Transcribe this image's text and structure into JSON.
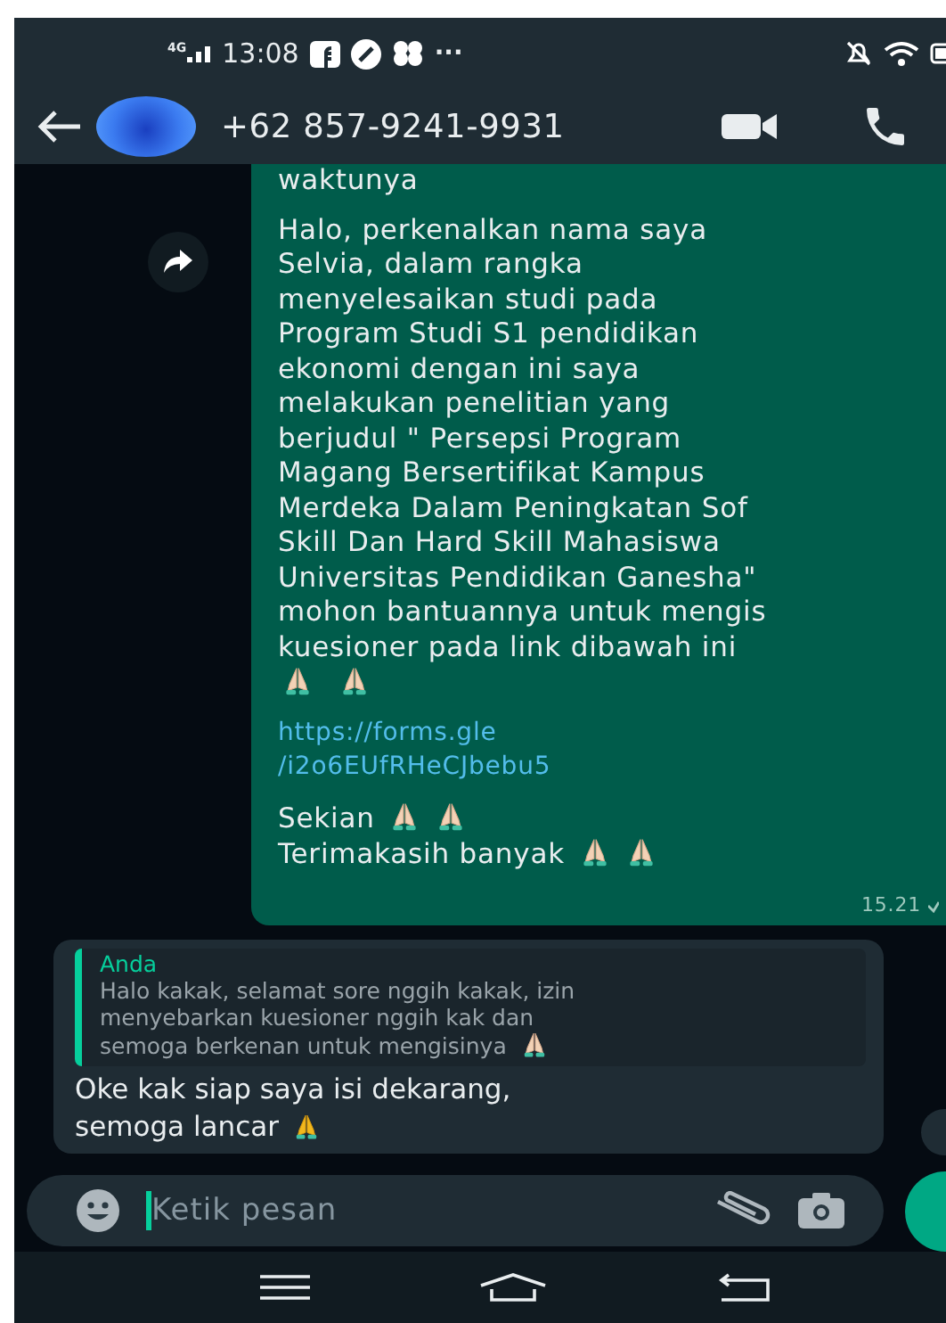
{
  "status_bar": {
    "network": "4G",
    "time": "13:08",
    "more": "···"
  },
  "header": {
    "contact": "+62 857-9241-9931"
  },
  "messages": [
    {
      "kind": "outgoing",
      "time": "15.21",
      "blocks": [
        [
          [
            {
              "kind": "text",
              "text": "waktunya"
            }
          ]
        ],
        [
          [
            {
              "kind": "text",
              "text": "Halo, perkenalkan nama saya\nSelvia, dalam rangka\nmenyelesaikan studi pada\nProgram Studi S1 pendidikan\nekonomi dengan ini saya\nmelakukan penelitian yang\nberjudul \" Persepsi Program\nMagang Bersertifikat Kampus\nMerdeka Dalam Peningkatan Sof\nSkill Dan Hard Skill Mahasiswa\nUniversitas Pendidikan Ganesha\"\nmohon bantuannya untuk mengis\nkuesioner pada link dibawah ini"
            }
          ],
          [
            {
              "kind": "praying-hands-light"
            },
            {
              "kind": "praying-hands-light"
            }
          ]
        ],
        [
          [
            {
              "kind": "link",
              "text": "https://forms.gle\n/i2o6EUfRHeCJbebu5"
            }
          ]
        ],
        [
          [
            {
              "kind": "text",
              "text": "Sekian"
            },
            {
              "kind": "praying-hands-light"
            },
            {
              "kind": "praying-hands-light"
            }
          ],
          [
            {
              "kind": "text",
              "text": "Terimakasih banyak"
            },
            {
              "kind": "praying-hands-light"
            },
            {
              "kind": "praying-hands-light"
            }
          ]
        ]
      ]
    },
    {
      "kind": "incoming",
      "quote": {
        "author": "Anda",
        "lines": [
          [
            {
              "kind": "text",
              "text": "Halo kakak, selamat sore nggih kakak, izin\nmenyebarkan kuesioner nggih kak dan"
            }
          ],
          [
            {
              "kind": "text",
              "text": "semoga berkenan untuk mengisinya"
            },
            {
              "kind": "praying-hands-light"
            }
          ]
        ]
      },
      "blocks": [
        [
          [
            {
              "kind": "text",
              "text": "Oke kak siap saya isi dekarang,"
            }
          ],
          [
            {
              "kind": "text",
              "text": "semoga lancar"
            },
            {
              "kind": "praying-hands"
            }
          ]
        ]
      ]
    }
  ],
  "composer": {
    "placeholder": "Ketik pesan"
  }
}
